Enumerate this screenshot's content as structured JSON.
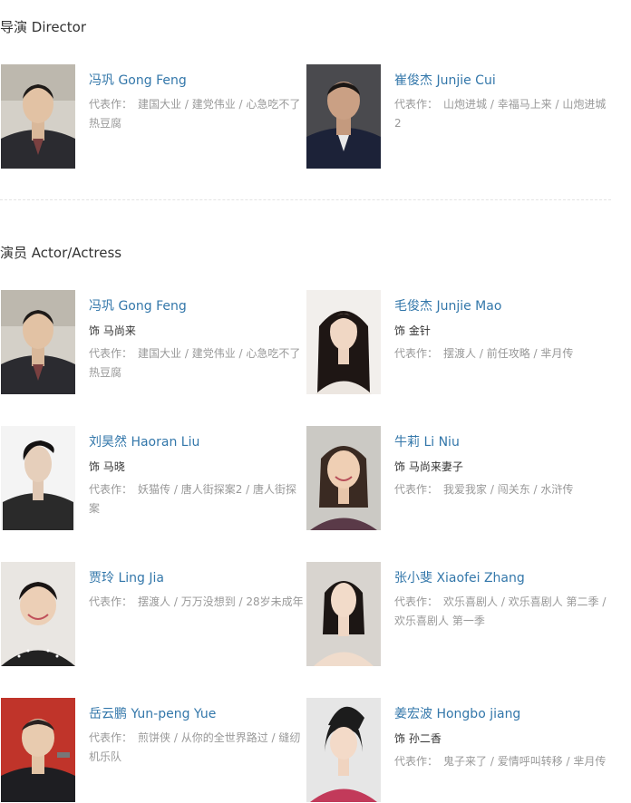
{
  "sections": {
    "director_title": "导演 Director",
    "cast_title": "演员 Actor/Actress"
  },
  "works_label": "代表作：",
  "directors": [
    {
      "name": "冯巩 Gong Feng",
      "works": "建国大业 / 建党伟业 / 心急吃不了热豆腐"
    },
    {
      "name": "崔俊杰 Junjie Cui",
      "works": "山炮进城 / 幸福马上来 / 山炮进城2"
    }
  ],
  "cast": [
    {
      "name": "冯巩 Gong Feng",
      "role": "饰 马尚来",
      "works": "建国大业 / 建党伟业 / 心急吃不了热豆腐"
    },
    {
      "name": "毛俊杰 Junjie Mao",
      "role": "饰 金针",
      "works": "摆渡人 / 前任攻略 / 芈月传"
    },
    {
      "name": "刘昊然 Haoran Liu",
      "role": "饰 马晓",
      "works": "妖猫传 / 唐人街探案2 / 唐人街探案"
    },
    {
      "name": "牛莉 Li Niu",
      "role": "饰 马尚来妻子",
      "works": "我爱我家 / 闯关东 / 水浒传"
    },
    {
      "name": "贾玲 Ling Jia",
      "role": "",
      "works": "摆渡人 / 万万没想到 / 28岁未成年"
    },
    {
      "name": "张小斐 Xiaofei Zhang",
      "role": "",
      "works": "欢乐喜剧人 / 欢乐喜剧人 第二季 / 欢乐喜剧人 第一季"
    },
    {
      "name": "岳云鹏 Yun-peng Yue",
      "role": "",
      "works": "煎饼侠 / 从你的全世界路过 / 缝纫机乐队"
    },
    {
      "name": "姜宏波 Hongbo jiang",
      "role": "饰 孙二香",
      "works": "鬼子来了 / 爱情呼叫转移 / 芈月传"
    }
  ]
}
